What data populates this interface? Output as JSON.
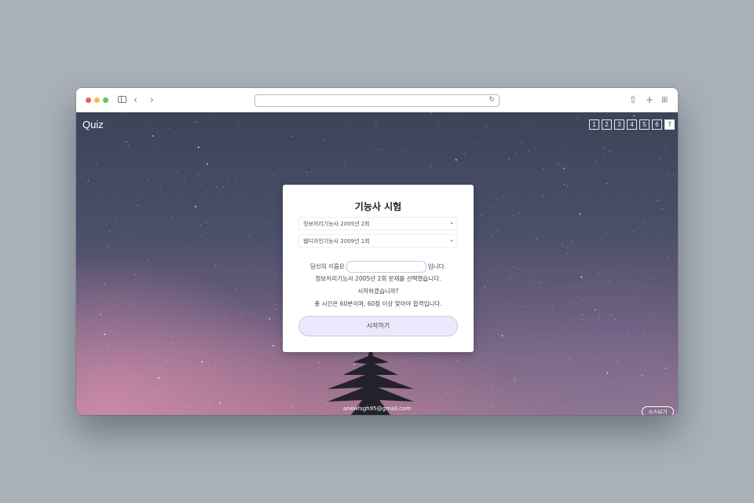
{
  "browser": {
    "address_value": ""
  },
  "page": {
    "brand": "Quiz",
    "pager": [
      "1",
      "2",
      "3",
      "4",
      "5",
      "6",
      "7"
    ],
    "pager_active_index": 6,
    "footer_email": "anewfsgh95@gmail.com",
    "source_button": "소스보기"
  },
  "card": {
    "title": "기능사 시험",
    "exam_select": "정보처리기능사 2005년 2회",
    "design_select": "웹디자인기능사 2009년 1회",
    "name_prefix": "당신의 이름은",
    "name_suffix": "입니다.",
    "selected_text": "정보처리기능사 2005년 2회 문제를 선택했습니다.",
    "question": "시작하겠습니까?",
    "rules": "총 시간은 60분이며, 60점 이상 맞아야 합격입니다.",
    "start_button": "시작하기"
  },
  "colors": {
    "accent": "#ebe9fb",
    "accent_border": "#c9c3f0"
  }
}
